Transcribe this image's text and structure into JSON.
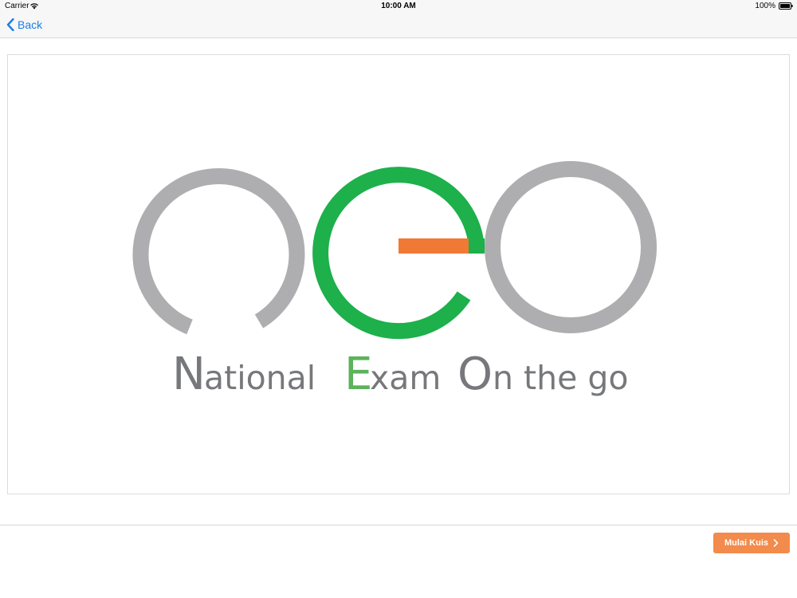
{
  "status_bar": {
    "carrier": "Carrier",
    "time": "10:00 AM",
    "battery_percent": "100%",
    "wifi_icon": "wifi-icon",
    "battery_icon": "battery-icon"
  },
  "navbar": {
    "back_label": "Back",
    "back_icon": "chevron-left-icon"
  },
  "logo": {
    "letters": [
      "n",
      "e",
      "o"
    ],
    "tagline": {
      "national_initial": "N",
      "national_rest": "ational",
      "exam_initial": "E",
      "exam_rest": "xam",
      "on_initial": "O",
      "on_rest": "n the go"
    },
    "colors": {
      "gray": "#aeadaf",
      "green": "#1db04b",
      "orange": "#f07a35",
      "text_gray": "#77787b",
      "text_green": "#5bb35a"
    }
  },
  "footer": {
    "start_label": "Mulai Kuis",
    "start_icon": "chevron-right-icon",
    "accent": "#f28b4b"
  }
}
